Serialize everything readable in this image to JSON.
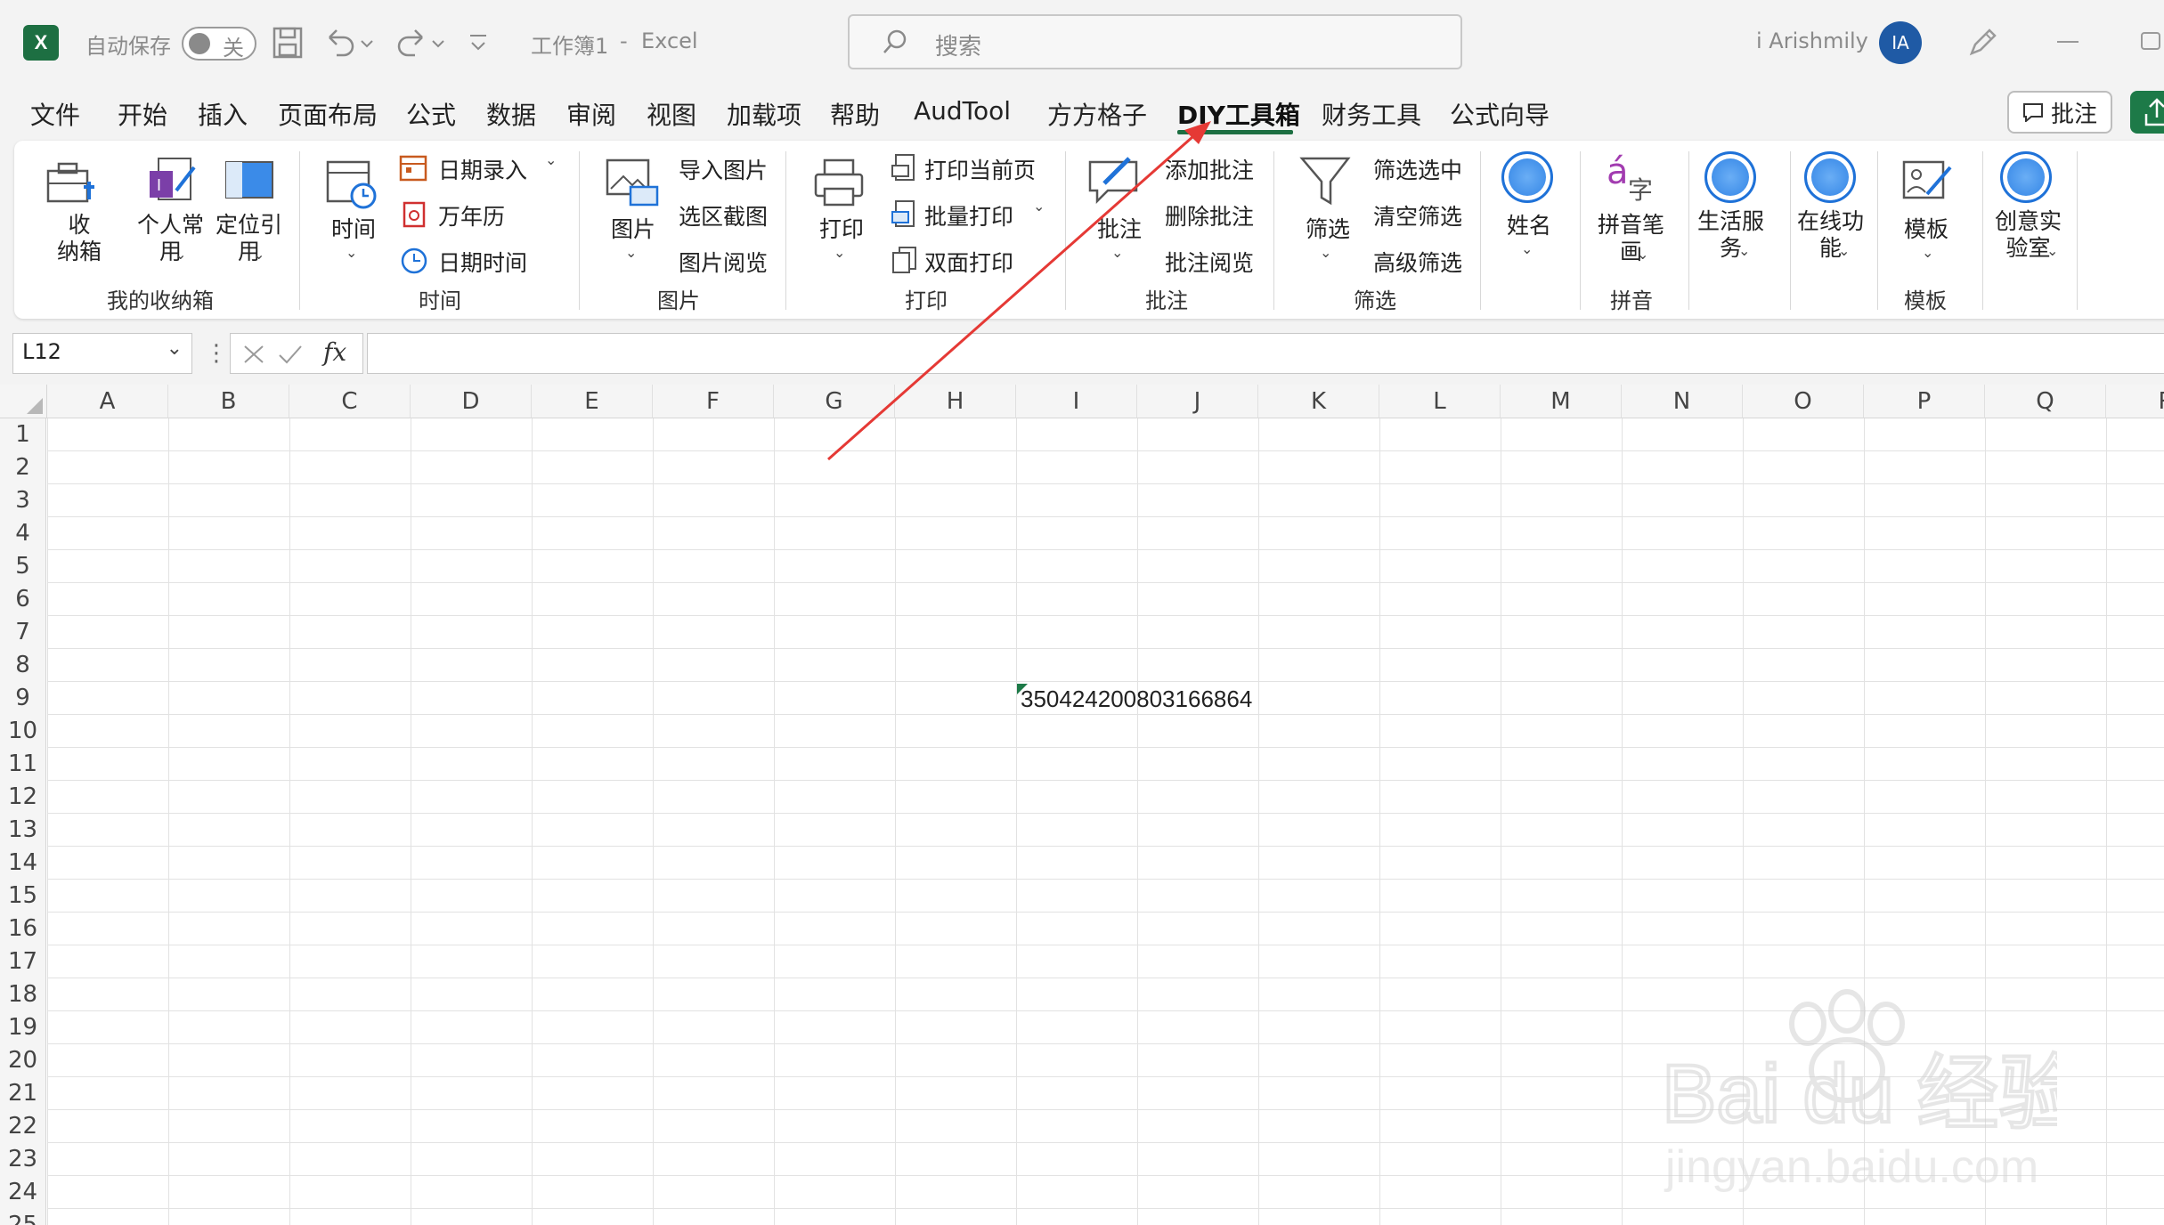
{
  "titlebar": {
    "autosave_label": "自动保存",
    "autosave_state": "关",
    "file_title": "工作簿1",
    "title_sep": "-",
    "app_name": "Excel",
    "search_placeholder": "搜索",
    "username": "i Arishmily",
    "avatar_initials": "IA"
  },
  "menu": {
    "tabs": [
      "文件",
      "开始",
      "插入",
      "页面布局",
      "公式",
      "数据",
      "审阅",
      "视图",
      "加载项",
      "帮助",
      "AudTool",
      "方方格子",
      "DIY工具箱",
      "财务工具",
      "公式向导"
    ],
    "active_tab": "DIY工具箱",
    "comment_button": "批注"
  },
  "ribbon": {
    "storage": {
      "btn_collect": "收\n纳箱",
      "btn_personal": "个人常\n用",
      "btn_locate": "定位引\n用",
      "group": "我的收纳箱"
    },
    "time": {
      "btn_time": "时间",
      "date_entry": "日期录入",
      "calendar": "万年历",
      "datetime": "日期时间",
      "group": "时间"
    },
    "picture": {
      "btn_picture": "图片",
      "import": "导入图片",
      "screenshot": "选区截图",
      "browse": "图片阅览",
      "group": "图片"
    },
    "print": {
      "btn_print": "打印",
      "print_current": "打印当前页",
      "batch_print": "批量打印",
      "duplex": "双面打印",
      "group": "打印"
    },
    "comment": {
      "btn_comment": "批注",
      "add": "添加批注",
      "delete": "删除批注",
      "browse": "批注阅览",
      "group": "批注"
    },
    "filter": {
      "btn_filter": "筛选",
      "filter_selected": "筛选选中",
      "clear_filter": "清空筛选",
      "advanced": "高级筛选",
      "group": "筛选"
    },
    "name": {
      "btn": "姓名"
    },
    "pinyin": {
      "btn": "拼音笔\n画",
      "icon_a": "á",
      "icon_zi": "字",
      "group": "拼音"
    },
    "life": {
      "btn": "生活服\n务"
    },
    "online": {
      "btn": "在线功\n能"
    },
    "template": {
      "btn": "模板",
      "group": "模板"
    },
    "lab": {
      "btn": "创意实\n验室"
    }
  },
  "formula_bar": {
    "name_box": "L12",
    "fx": "fx",
    "formula": ""
  },
  "sheet": {
    "columns": [
      "A",
      "B",
      "C",
      "D",
      "E",
      "F",
      "G",
      "H",
      "I",
      "J",
      "K",
      "L",
      "M",
      "N",
      "O",
      "P",
      "Q",
      "R"
    ],
    "rows": [
      "1",
      "2",
      "3",
      "4",
      "5",
      "6",
      "7",
      "8",
      "9",
      "10",
      "11",
      "12",
      "13",
      "14",
      "15",
      "16",
      "17",
      "18",
      "19",
      "20",
      "21",
      "22",
      "23",
      "24",
      "25"
    ],
    "cell_I9": "350424200803166864"
  },
  "watermark": {
    "brand": "Bai du 经验",
    "url": "jingyan.baidu.com"
  },
  "colors": {
    "excel_green": "#1d6f42",
    "arrow_red": "#e53935",
    "accent_blue": "#1f72d8"
  }
}
